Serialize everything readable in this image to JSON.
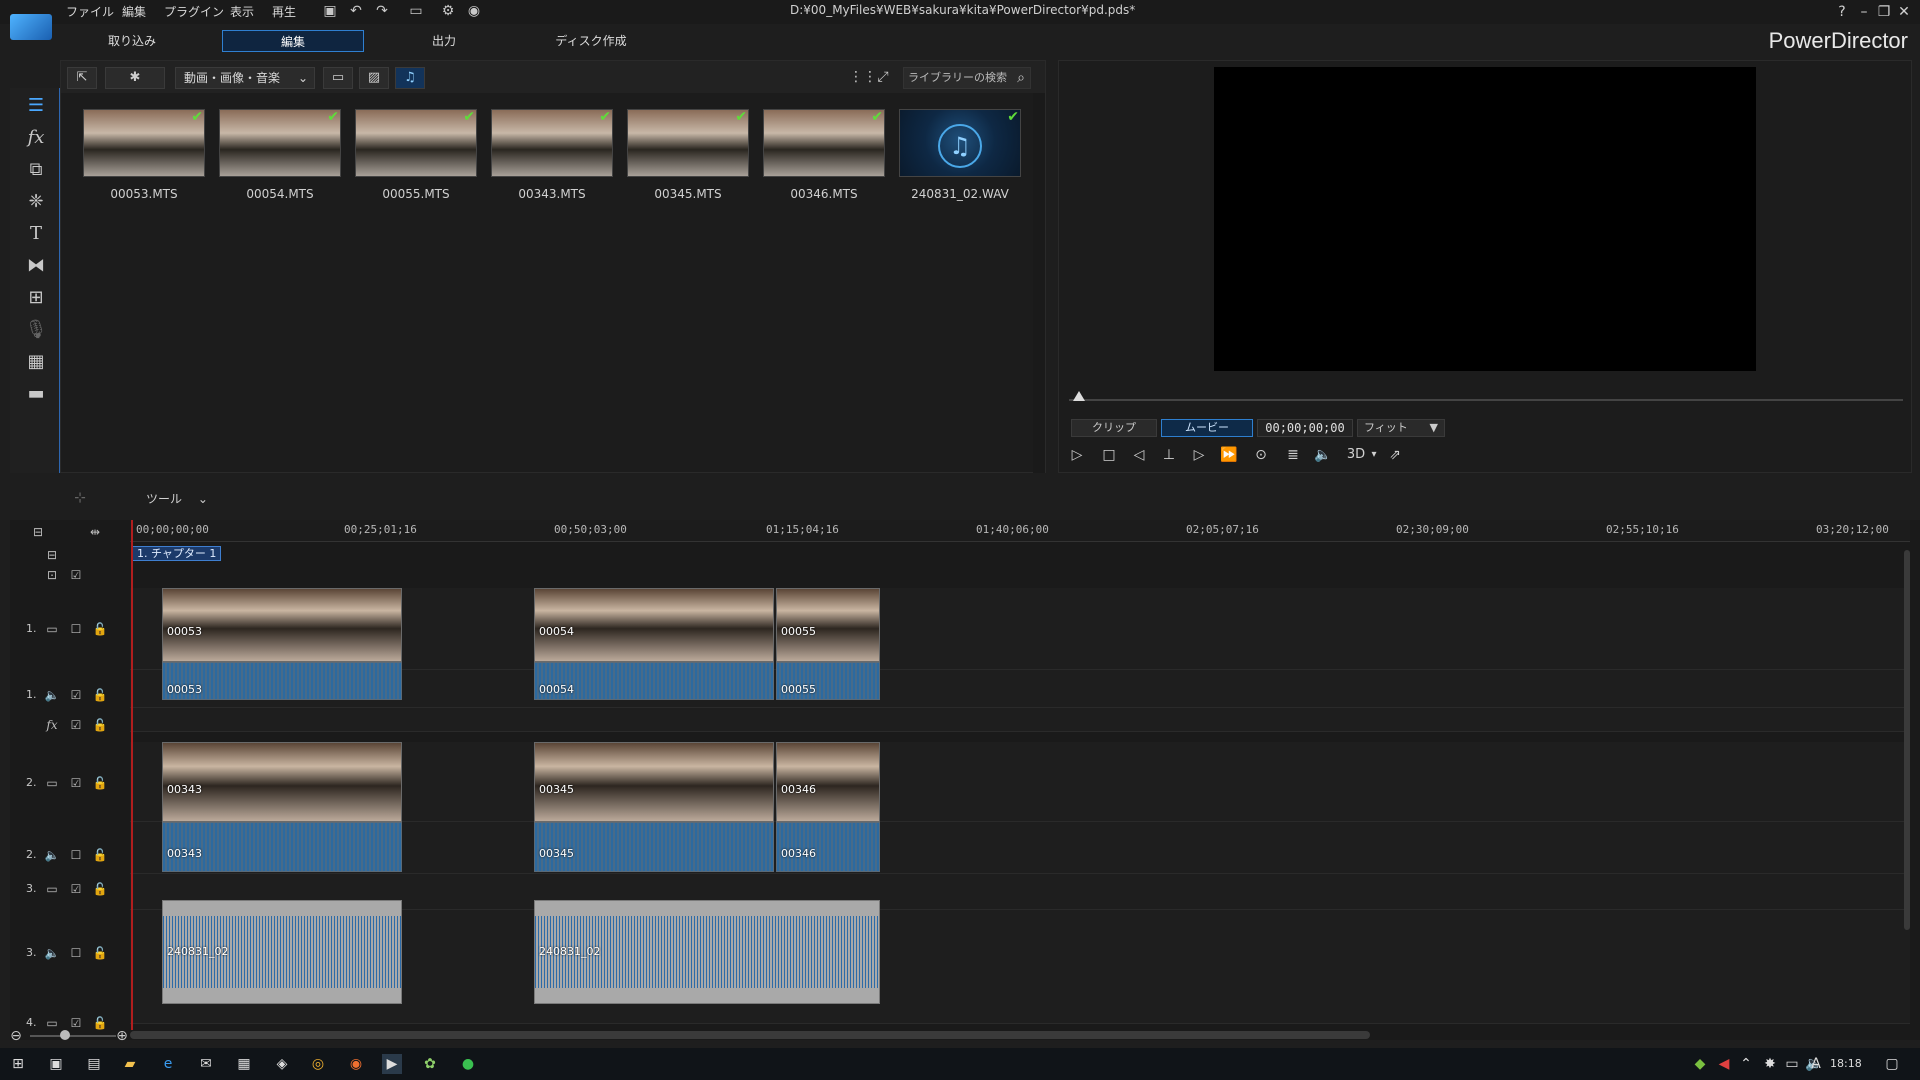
{
  "app": {
    "menu": [
      "ファイル",
      "編集",
      "プラグイン",
      "表示",
      "再生"
    ],
    "file_path": "D:¥00_MyFiles¥WEB¥sakura¥kita¥PowerDirector¥pd.pds*",
    "brand": "PowerDirector"
  },
  "mode_tabs": [
    {
      "label": "取り込み",
      "active": false
    },
    {
      "label": "編集",
      "active": true
    },
    {
      "label": "出力",
      "active": false
    },
    {
      "label": "ディスク作成",
      "active": false
    }
  ],
  "library": {
    "filter_select": "動画・画像・音楽",
    "search_placeholder": "ライブラリーの検索",
    "items": [
      {
        "name": "00053.MTS",
        "type": "video"
      },
      {
        "name": "00054.MTS",
        "type": "video"
      },
      {
        "name": "00055.MTS",
        "type": "video"
      },
      {
        "name": "00343.MTS",
        "type": "video"
      },
      {
        "name": "00345.MTS",
        "type": "video"
      },
      {
        "name": "00346.MTS",
        "type": "video"
      },
      {
        "name": "240831_02.WAV",
        "type": "audio"
      }
    ]
  },
  "preview": {
    "tab_clip": "クリップ",
    "tab_movie": "ムービー",
    "timecode": "00;00;00;00",
    "fit": "フィット",
    "label_3d": "3D"
  },
  "timeline_toolbar": {
    "tools_label": "ツール"
  },
  "timeline": {
    "ruler": [
      "00;00;00;00",
      "00;25;01;16",
      "00;50;03;00",
      "01;15;04;16",
      "01;40;06;00",
      "02;05;07;16",
      "02;30;09;00",
      "02;55;10;16",
      "03;20;12;00"
    ],
    "chapter": "1. チャプター 1",
    "track_numbers": {
      "t1v": "1.",
      "t1a": "1.",
      "t2v": "2.",
      "t2a": "2.",
      "t3v": "3.",
      "t3a": "3.",
      "t4v": "4."
    },
    "clips": {
      "t1v": [
        "00053",
        "00054",
        "00055"
      ],
      "t1a": [
        "00053",
        "00054",
        "00055"
      ],
      "t2v": [
        "00343",
        "00345",
        "00346"
      ],
      "t2a": [
        "00343",
        "00345",
        "00346"
      ],
      "t3a": [
        "240831_02",
        "240831_02"
      ]
    }
  },
  "taskbar": {
    "ime": "A",
    "clock": "18:18"
  }
}
